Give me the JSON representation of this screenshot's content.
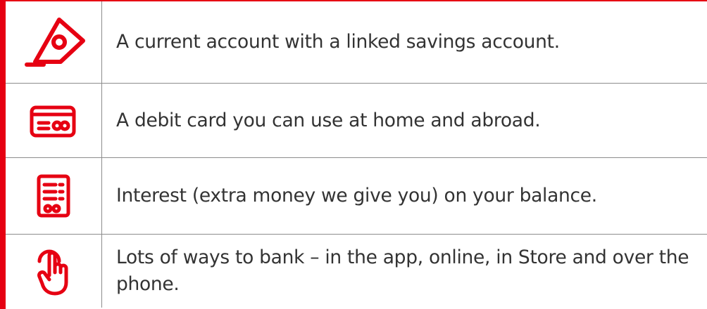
{
  "brand": {
    "accent_color": "#e60012",
    "text_color": "#333333",
    "rule_color": "#8c8c8c"
  },
  "features": [
    {
      "icon": "price-tag-icon",
      "text": "A current account with a linked savings account."
    },
    {
      "icon": "debit-card-icon",
      "text": "A debit card you can use at home and abroad."
    },
    {
      "icon": "receipt-coins-icon",
      "text": "Interest (extra money we give you) on your balance."
    },
    {
      "icon": "tap-hand-icon",
      "text": "Lots of ways to bank – in the app, online, in Store and over the phone."
    }
  ]
}
